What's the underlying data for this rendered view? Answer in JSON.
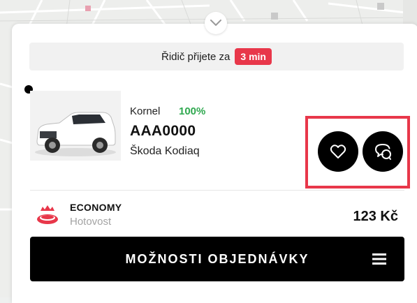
{
  "eta": {
    "text": "Řidič přijete za",
    "badge": "3 min",
    "badge_color": "#e8374a"
  },
  "driver": {
    "name": "Kornel",
    "rating": "100%",
    "rating_color": "#2fa84f"
  },
  "vehicle": {
    "plate": "AAA0000",
    "model": "Škoda Kodiaq"
  },
  "actions": {
    "favorite_icon": "heart-icon",
    "chat_icon": "chat-icon"
  },
  "order": {
    "tariff": "ECONOMY",
    "payment": "Hotovost",
    "price": "123 Kč"
  },
  "options_button": {
    "label": "MOŽNOSTI OBJEDNÁVKY",
    "icon": "menu-icon"
  },
  "colors": {
    "accent": "#e8374a",
    "button_bg": "#000000"
  }
}
